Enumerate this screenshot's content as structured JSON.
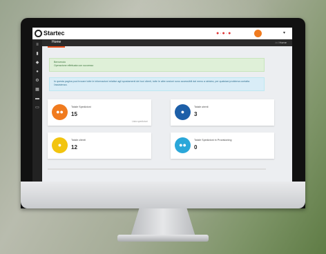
{
  "app": {
    "brand": "Startec",
    "home_tab": "Home",
    "breadcrumb": "/ Home",
    "avatar_color": "#f07b1f"
  },
  "sidebar": {
    "icons": [
      "menu-icon",
      "file-icon",
      "bookmark-icon",
      "users-icon",
      "settings-icon",
      "building-icon",
      "truck-icon",
      "card-icon"
    ]
  },
  "alerts": {
    "success_title": "Benvenuto",
    "success_body": "Operazione effettuata con successo",
    "info_body": "In questa pagina puoi trovare tutte le informazioni relative agli spostamenti dei tuoi clienti, tutte le altre sezioni sono accessibili dal menu a sinistra, per qualsiasi problema contatta l'assistenza."
  },
  "cards": [
    {
      "label": "Totale Spedizioni",
      "value": "15",
      "link": "Lista spedizioni",
      "color": "#f07b1f"
    },
    {
      "label": "Totale utenti",
      "value": "3",
      "link": "",
      "color": "#1d5fa8"
    },
    {
      "label": "Totale clienti",
      "value": "12",
      "link": "",
      "color": "#f2c40f"
    },
    {
      "label": "Totale Spedizioni in Provisioning",
      "value": "0",
      "link": "",
      "color": "#2aa7d9"
    }
  ]
}
